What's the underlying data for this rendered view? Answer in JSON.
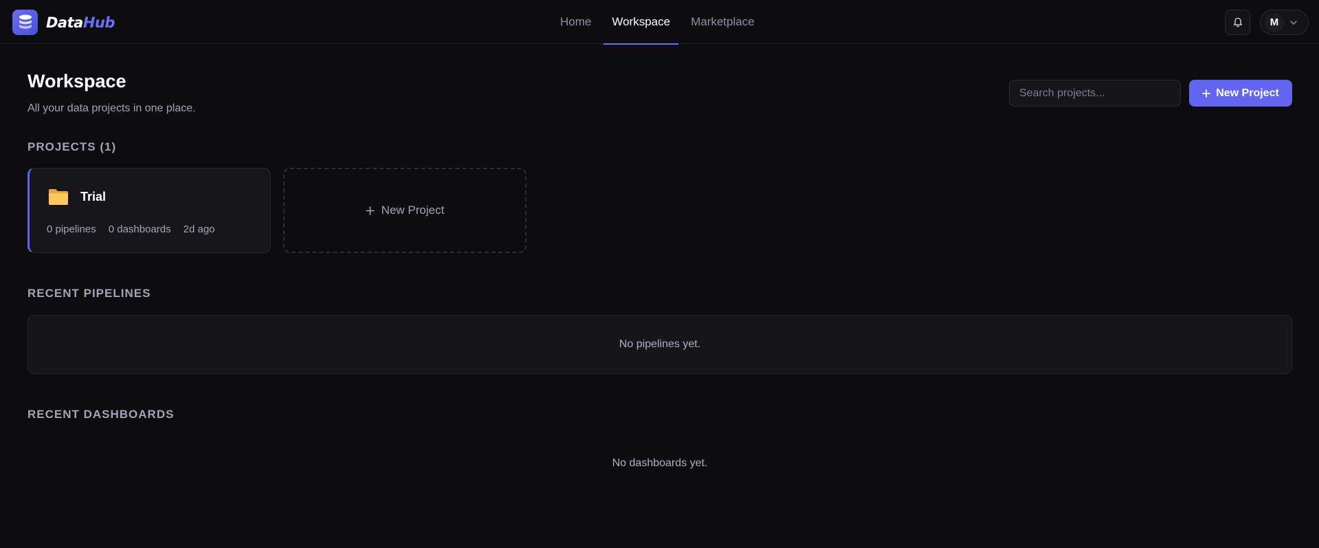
{
  "brand": {
    "name_part1": "Data",
    "name_part2": "Hub",
    "logo_icon": "database-stack-icon",
    "accent_color": "#6165f0"
  },
  "nav": {
    "items": [
      {
        "label": "Home",
        "active": false
      },
      {
        "label": "Workspace",
        "active": true
      },
      {
        "label": "Marketplace",
        "active": false
      }
    ]
  },
  "header_actions": {
    "notification_icon": "bell-icon",
    "user_initial": "M",
    "user_menu_icon": "chevron-down-icon"
  },
  "page": {
    "title": "Workspace",
    "subtitle": "All your data projects in one place."
  },
  "toolbar": {
    "search_placeholder": "Search projects...",
    "search_value": "",
    "new_project_icon": "plus-icon",
    "new_project_label": "New Project"
  },
  "projects": {
    "heading": "PROJECTS (1)",
    "items": [
      {
        "name": "Trial",
        "icon": "folder-icon",
        "pipelines": "0 pipelines",
        "dashboards": "0 dashboards",
        "updated": "2d ago"
      }
    ],
    "new_card_label": "New Project",
    "new_card_icon": "plus-icon"
  },
  "recent_pipelines": {
    "heading": "RECENT PIPELINES",
    "empty_text": "No pipelines yet."
  },
  "recent_dashboards": {
    "heading": "RECENT DASHBOARDS",
    "empty_text": "No dashboards yet."
  }
}
